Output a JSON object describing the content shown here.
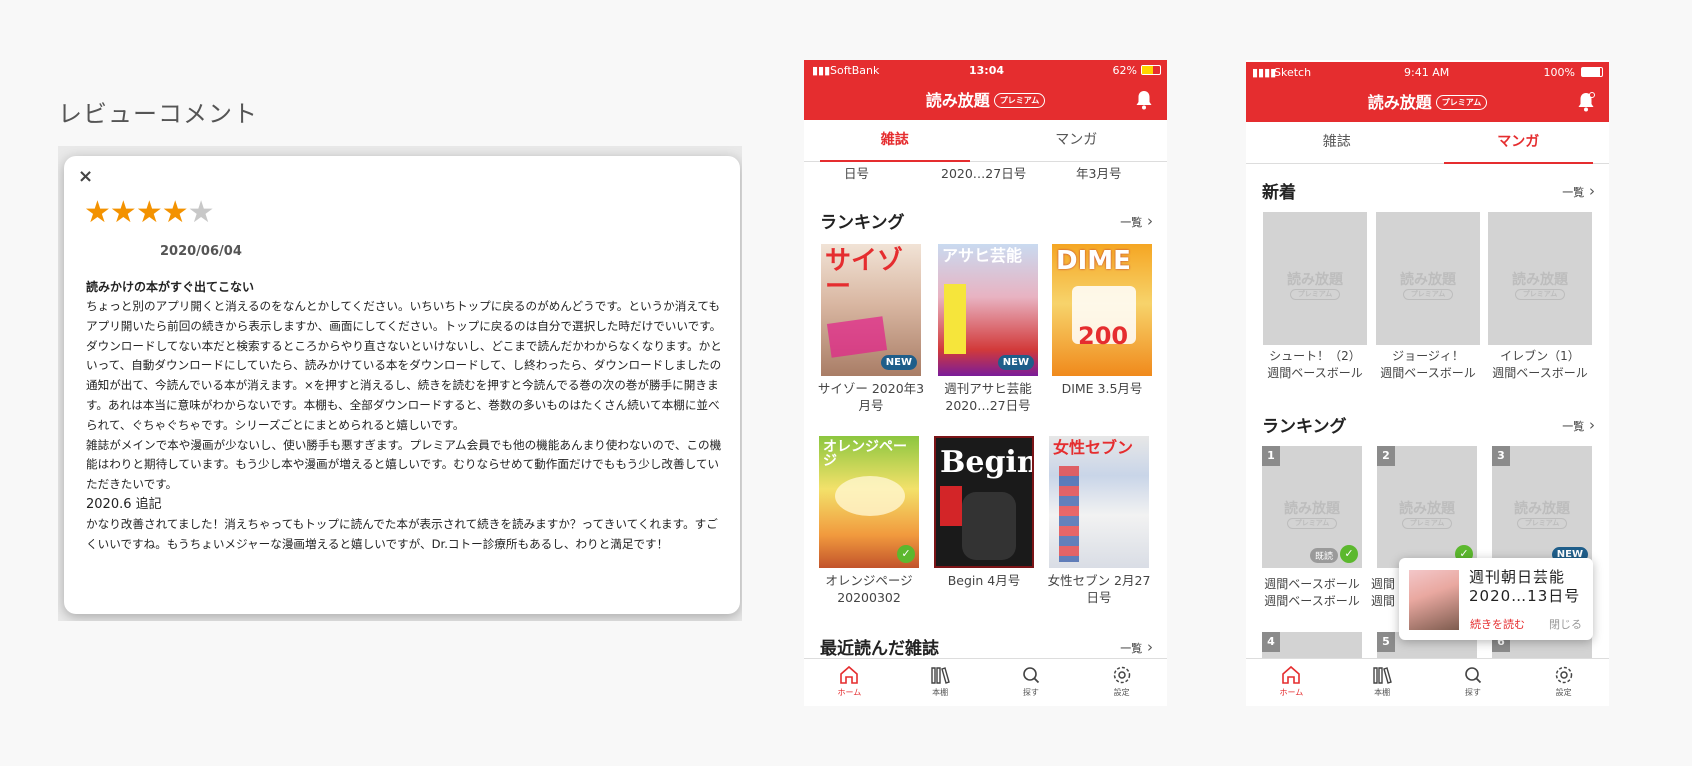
{
  "review": {
    "heading": "レビューコメント",
    "close_glyph": "×",
    "rating": 4,
    "max_rating": 5,
    "star_glyph": "★",
    "date": "2020/06/04",
    "title": "読みかけの本がすぐ出てこない",
    "paragraph_1": "ちょっと別のアプリ開くと消えるのをなんとかしてください。いちいちトップに戻るのがめんどうです。というか消えてもアプリ開いたら前回の続きから表示しますか、画面にしてください。トップに戻るのは自分で選択した時だけでいいです。ダウンロードしてない本だと検索するところからやり直さないといけないし、どこまで読んだかわからなくなります。かといって、自動ダウンロードにしていたら、読みかけている本をダウンロードして、し終わったら、ダウンロードしましたの通知が出て、今読んでいる本が消えます。×を押すと消えるし、続きを読むを押すと今読んでる巻の次の巻が勝手に開きます。あれは本当に意味がわからないです。本棚も、全部ダウンロードすると、巻数の多いものはたくさん続いて本棚に並べられて、ぐちゃぐちゃです。シリーズごとにまとめられると嬉しいです。",
    "paragraph_2": "雑誌がメインで本や漫画が少ないし、使い勝手も悪すぎます。プレミアム会員でも他の機能あんまり使わないので、この機能はわりと期待しています。もう少し本や漫画が増えると嬉しいです。むりならせめて動作面だけでももう少し改善していただきたいです。",
    "addendum_title": "2020.6 追記",
    "paragraph_3": "かなり改善されてました！消えちゃってもトップに読んでた本が表示されて続きを読みますか？ってきいてくれます。すごくいいですね。もうちょいメジャーな漫画増えると嬉しいですが、Dr.コトー診療所もあるし、わりと満足です！"
  },
  "phone_a": {
    "status": {
      "carrier": "SoftBank",
      "time": "13:04",
      "battery": "62%"
    },
    "app_title": "読み放題",
    "premium_badge": "プレミアム",
    "tabs": [
      "雑誌",
      "マンガ"
    ],
    "active_tab": 0,
    "clipped_labels": [
      "日号",
      "2020…27日号",
      "年3月号"
    ],
    "ranking_title": "ランキング",
    "more_label": "一覧",
    "magazines": [
      {
        "label": "サイゾー 2020年3月号",
        "cover_text": "サイゾー",
        "badge": "NEW"
      },
      {
        "label": "週刊アサヒ芸能 2020…27日号",
        "cover_text": "アサヒ芸能",
        "badge": "NEW"
      },
      {
        "label": "DIME 3.5月号",
        "cover_text": "DIME",
        "badge": ""
      },
      {
        "label": "オレンジページ 20200302",
        "cover_text": "オレンジページ",
        "badge": "check"
      },
      {
        "label": "Begin 4月号",
        "cover_text": "Begin",
        "badge": ""
      },
      {
        "label": "女性セブン 2月27日号",
        "cover_text": "女性セブン",
        "badge": ""
      }
    ],
    "recent_title": "最近読んだ雑誌",
    "nav": [
      "ホーム",
      "本棚",
      "探す",
      "設定"
    ]
  },
  "phone_b": {
    "status": {
      "carrier": "Sketch",
      "time": "9:41 AM",
      "battery": "100%"
    },
    "app_title": "読み放題",
    "premium_badge": "プレミアム",
    "tabs": [
      "雑誌",
      "マンガ"
    ],
    "active_tab": 1,
    "new_title": "新着",
    "more_label": "一覧",
    "new_items": [
      {
        "title": "シュート！（2）",
        "publisher": "週間ベースボール"
      },
      {
        "title": "ジョージィ！",
        "publisher": "週間ベースボール"
      },
      {
        "title": "イレブン（1）",
        "publisher": "週間ベースボール"
      }
    ],
    "ranking_title": "ランキング",
    "ranking_items": [
      {
        "rank": "1",
        "title": "週間ベースボール",
        "publisher": "週間ベースボール",
        "badge": "既読"
      },
      {
        "rank": "2",
        "title": "週間",
        "publisher": "週間",
        "badge": "check"
      },
      {
        "rank": "3",
        "title": "",
        "publisher": "",
        "badge": "NEW"
      }
    ],
    "ranking_items_row2": [
      "4",
      "5",
      "6"
    ],
    "placeholder_logo": "読み放題",
    "placeholder_badge": "プレミアム",
    "popup": {
      "title": "週刊朝日芸能 2020…13日号",
      "read_label": "続きを読む",
      "close_label": "閉じる"
    },
    "nav": [
      "ホーム",
      "本棚",
      "探す",
      "設定"
    ]
  },
  "colors": {
    "brand_red": "#e52d2f",
    "star": "#f39200",
    "new_badge": "#1f5e8a",
    "check": "#5cb82e"
  }
}
